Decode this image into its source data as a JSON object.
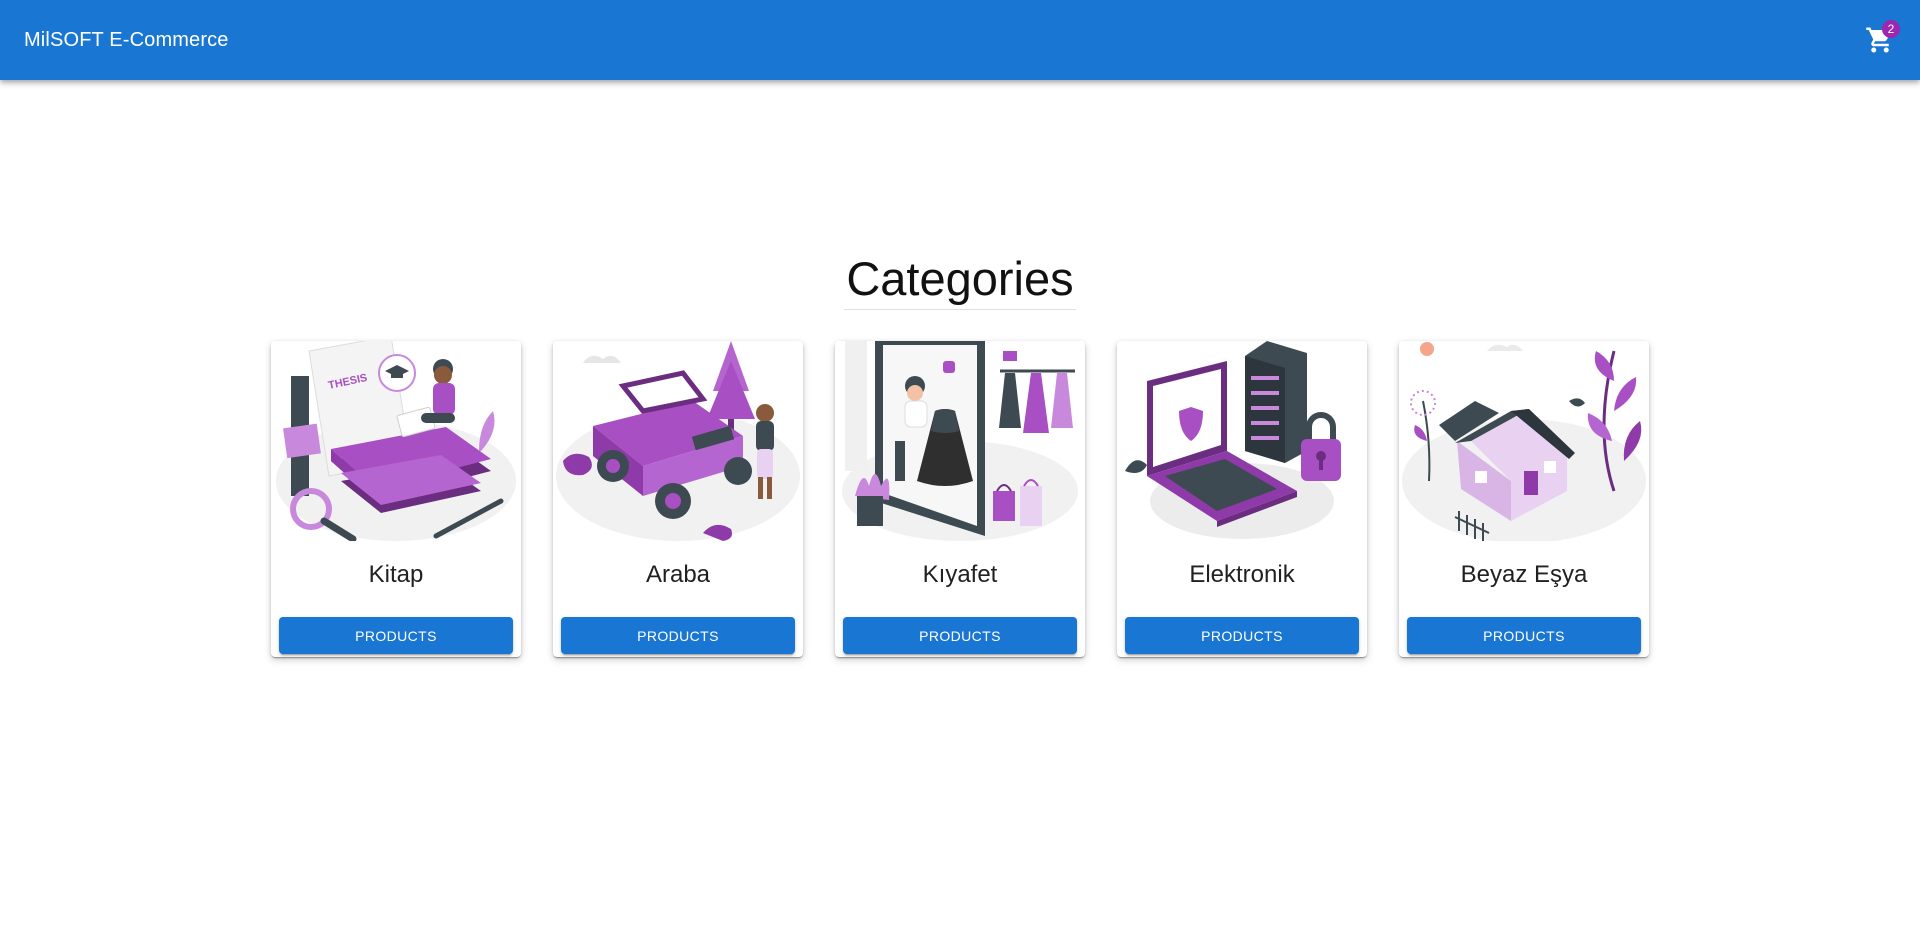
{
  "header": {
    "brand": "MilSOFT E-Commerce",
    "cart_icon": "shopping-cart-icon",
    "cart_count": "2"
  },
  "main": {
    "title": "Categories",
    "categories": [
      {
        "name": "Kitap",
        "button_label": "PRODUCTS",
        "illustration": "reading-books-illustration"
      },
      {
        "name": "Araba",
        "button_label": "PRODUCTS",
        "illustration": "jeep-car-illustration"
      },
      {
        "name": "Kıyafet",
        "button_label": "PRODUCTS",
        "illustration": "clothing-shop-illustration"
      },
      {
        "name": "Elektronik",
        "button_label": "PRODUCTS",
        "illustration": "laptop-server-lock-illustration"
      },
      {
        "name": "Beyaz Eşya",
        "button_label": "PRODUCTS",
        "illustration": "house-plants-illustration"
      }
    ]
  },
  "colors": {
    "primary": "#1976d2",
    "badge": "#9c27b0",
    "illustration_accent": "#a94fc4",
    "illustration_dark": "#3d4a52",
    "illustration_light": "#ececec"
  }
}
